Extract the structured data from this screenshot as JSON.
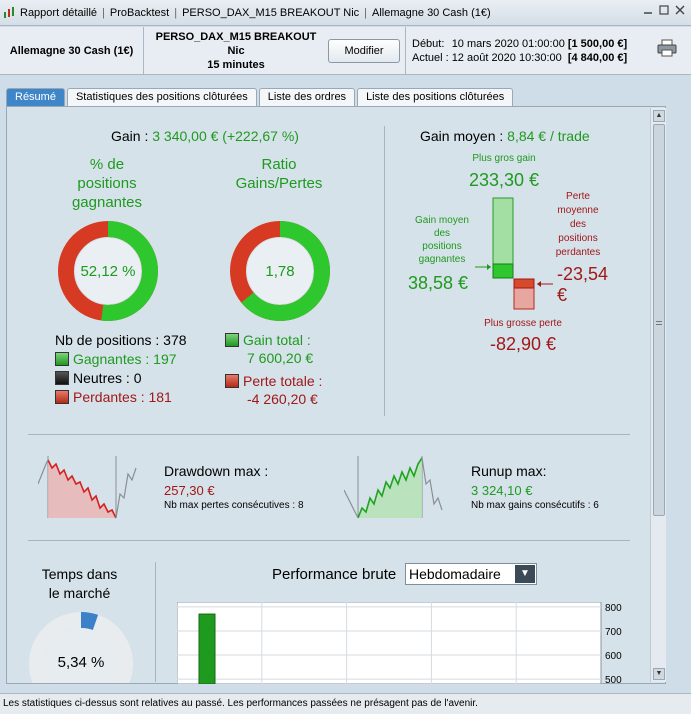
{
  "window": {
    "title_parts": [
      "Rapport détaillé",
      "ProBacktest",
      "PERSO_DAX_M15 BREAKOUT Nic",
      "Allemagne 30 Cash (1€)"
    ]
  },
  "header": {
    "instrument": "Allemagne 30 Cash (1€)",
    "strategy_name": "PERSO_DAX_M15 BREAKOUT Nic",
    "timeframe": "15 minutes",
    "modify_label": "Modifier",
    "start_label": "Début:",
    "start_date": "10 mars 2020 01:00:00",
    "start_value": "[1 500,00 €]",
    "current_label": "Actuel :",
    "current_date": "12 août 2020 10:30:00",
    "current_value": "[4 840,00 €]"
  },
  "tabs": [
    {
      "label": "Résumé",
      "active": true
    },
    {
      "label": "Statistiques des positions clôturées",
      "active": false
    },
    {
      "label": "Liste des ordres",
      "active": false
    },
    {
      "label": "Liste des positions clôturées",
      "active": false
    }
  ],
  "summary": {
    "gain_label": "Gain :",
    "gain_value": "3 340,00 € (+222,67 %)",
    "winning_pct_title_l1": "% de",
    "winning_pct_title_l2": "positions",
    "winning_pct_title_l3": "gagnantes",
    "winning_pct_value": "52,12 %",
    "winning_pct_fraction": 0.5212,
    "ratio_title_l1": "Ratio",
    "ratio_title_l2": "Gains/Pertes",
    "ratio_value": "1,78",
    "ratio_green_fraction": 0.64,
    "nb_positions": "Nb de positions : 378",
    "winners": "Gagnantes : 197",
    "neutral": "Neutres : 0",
    "losers": "Perdantes : 181",
    "total_gain_label": "Gain total :",
    "total_gain_value": "7 600,20 €",
    "total_loss_label": "Perte totale :",
    "total_loss_value": "-4 260,20 €"
  },
  "avg_gain": {
    "title": "Gain moyen :",
    "value": "8,84 € / trade",
    "biggest_gain_label": "Plus gros gain",
    "biggest_gain_value": "233,30 €",
    "avg_winning_label_l1": "Gain moyen",
    "avg_winning_label_l2": "des",
    "avg_winning_label_l3": "positions",
    "avg_winning_label_l4": "gagnantes",
    "avg_winning_value": "38,58 €",
    "avg_losing_label_l1": "Perte",
    "avg_losing_label_l2": "moyenne",
    "avg_losing_label_l3": "des",
    "avg_losing_label_l4": "positions",
    "avg_losing_label_l5": "perdantes",
    "avg_losing_value_num": "-23,54",
    "avg_losing_value_cur": "€",
    "biggest_loss_label": "Plus grosse perte",
    "biggest_loss_value": "-82,90 €"
  },
  "drawdown": {
    "title": "Drawdown max :",
    "value": "257,30 €",
    "sub": "Nb max pertes consécutives : 8"
  },
  "runup": {
    "title": "Runup max:",
    "value": "3 324,10 €",
    "sub": "Nb max gains consécutifs : 6"
  },
  "market_time": {
    "title_l1": "Temps dans",
    "title_l2": "le marché",
    "value": "5,34 %",
    "fraction": 0.0534
  },
  "performance": {
    "title": "Performance brute",
    "period_selected": "Hebdomadaire",
    "y_ticks": [
      "800",
      "700",
      "600",
      "500"
    ]
  },
  "chart_data": {
    "type": "bar",
    "title": "Performance brute",
    "ylim": [
      480,
      820
    ],
    "values": [
      770
    ]
  },
  "status_bar": {
    "text": "Les statistiques ci-dessus sont relatives au passé. Les performances passées ne présagent pas de l'avenir."
  },
  "colors": {
    "gain": "#1e9a1e",
    "loss": "#a01818",
    "tab_active": "#3f86c8"
  }
}
